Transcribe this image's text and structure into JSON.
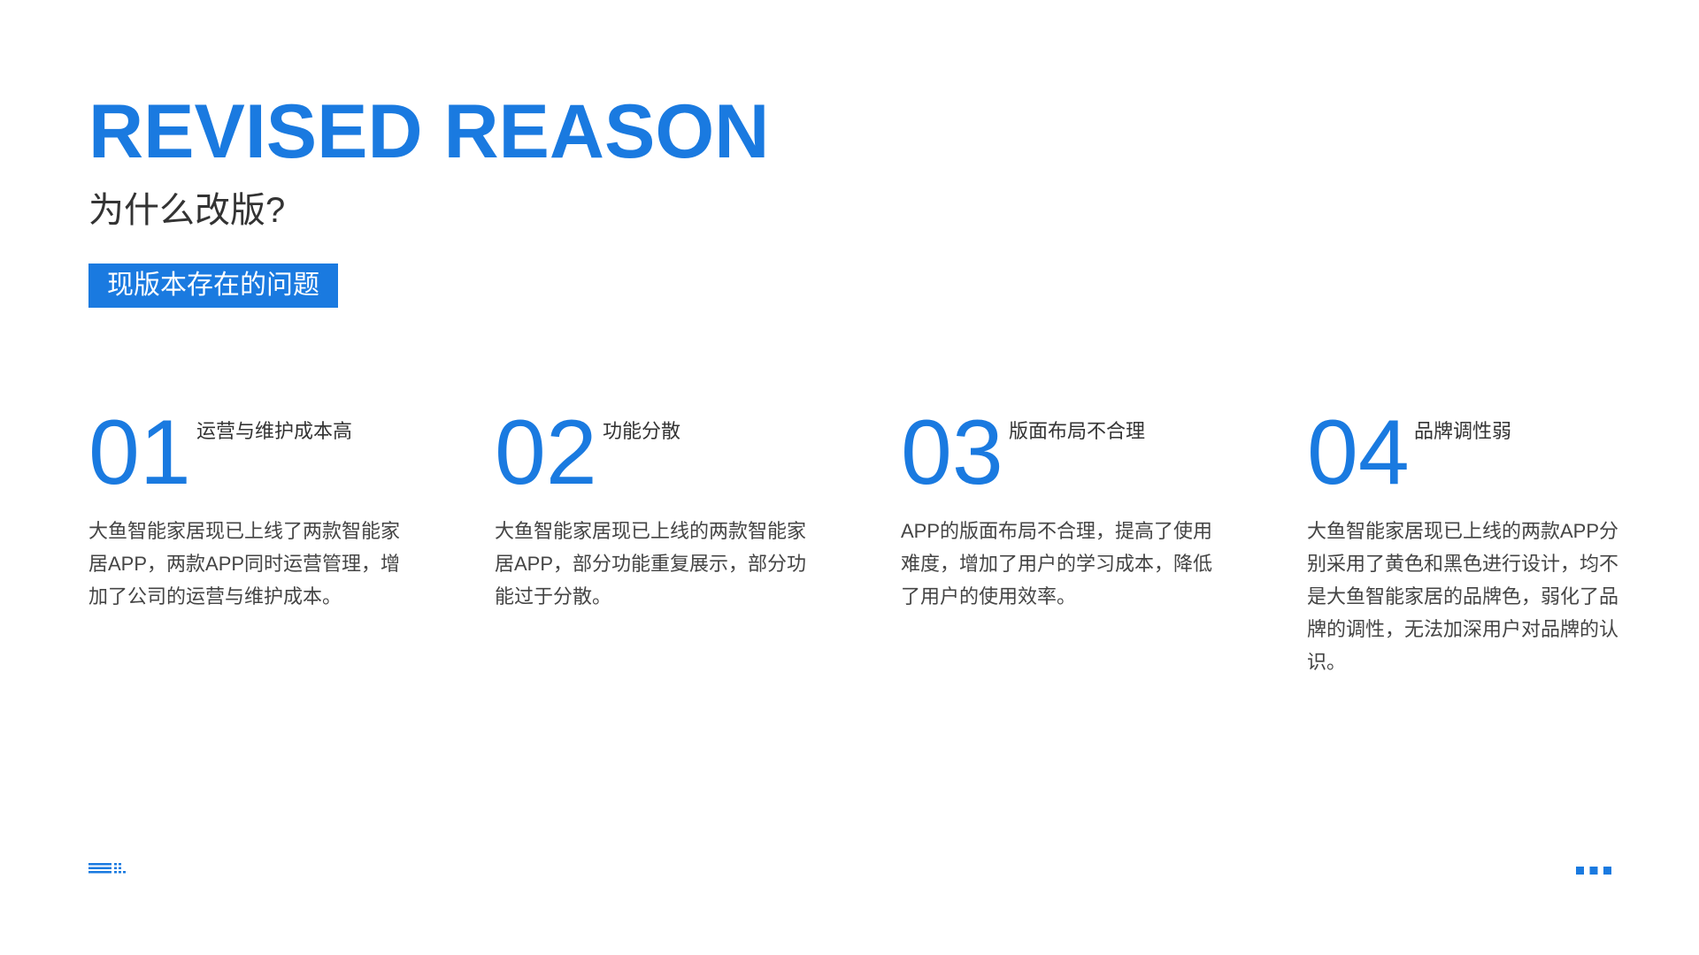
{
  "header": {
    "title": "REVISED REASON",
    "subtitle": "为什么改版?",
    "tag": "现版本存在的问题"
  },
  "items": [
    {
      "number": "01",
      "heading": "运营与维护成本高",
      "body": "大鱼智能家居现已上线了两款智能家居APP，两款APP同时运营管理，增加了公司的运营与维护成本。"
    },
    {
      "number": "02",
      "heading": "功能分散",
      "body": "大鱼智能家居现已上线的两款智能家居APP，部分功能重复展示，部分功能过于分散。"
    },
    {
      "number": "03",
      "heading": "版面布局不合理",
      "body": "APP的版面布局不合理，提高了使用难度，增加了用户的学习成本，降低了用户的使用效率。"
    },
    {
      "number": "04",
      "heading": "品牌调性弱",
      "body": "大鱼智能家居现已上线的两款APP分别采用了黄色和黑色进行设计，均不是大鱼智能家居的品牌色，弱化了品牌的调性，无法加深用户对品牌的认识。"
    }
  ],
  "colors": {
    "accent": "#1a7ae0",
    "text": "#333333",
    "background": "#ffffff"
  },
  "footer": {
    "left_icon": "lines-dots-decoration-icon",
    "right_icon": "three-dots-icon"
  }
}
